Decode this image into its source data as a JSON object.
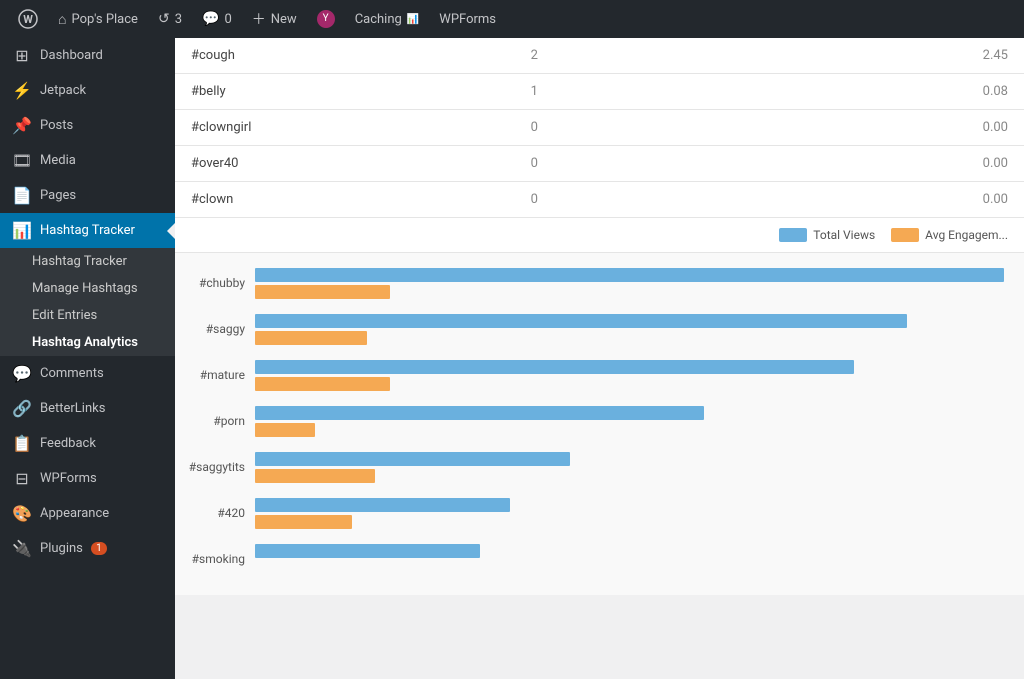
{
  "adminbar": {
    "wp_logo_label": "WordPress",
    "site_name": "Pop's Place",
    "updates_count": "3",
    "comments_count": "0",
    "new_label": "New",
    "yoast_label": "",
    "caching_label": "Caching",
    "wpforms_label": "WPForms"
  },
  "sidebar": {
    "items": [
      {
        "id": "dashboard",
        "label": "Dashboard",
        "icon": "⊞"
      },
      {
        "id": "jetpack",
        "label": "Jetpack",
        "icon": "⚡"
      },
      {
        "id": "posts",
        "label": "Posts",
        "icon": "📌"
      },
      {
        "id": "media",
        "label": "Media",
        "icon": "🎞"
      },
      {
        "id": "pages",
        "label": "Pages",
        "icon": "📄"
      },
      {
        "id": "hashtag-tracker",
        "label": "Hashtag Tracker",
        "icon": "📊",
        "active": true
      },
      {
        "id": "comments",
        "label": "Comments",
        "icon": "💬"
      },
      {
        "id": "betterlinks",
        "label": "BetterLinks",
        "icon": "🔗"
      },
      {
        "id": "feedback",
        "label": "Feedback",
        "icon": "📋"
      },
      {
        "id": "wpforms",
        "label": "WPForms",
        "icon": "⊟"
      },
      {
        "id": "appearance",
        "label": "Appearance",
        "icon": "🎨"
      },
      {
        "id": "plugins",
        "label": "Plugins",
        "icon": "🔌",
        "badge": "1"
      }
    ],
    "submenu": {
      "hashtag-tracker": [
        {
          "id": "hashtag-tracker-main",
          "label": "Hashtag Tracker"
        },
        {
          "id": "manage-hashtags",
          "label": "Manage Hashtags"
        },
        {
          "id": "edit-entries",
          "label": "Edit Entries"
        },
        {
          "id": "hashtag-analytics",
          "label": "Hashtag Analytics",
          "active": true
        }
      ]
    }
  },
  "table": {
    "rows": [
      {
        "tag": "#cough",
        "count": "2",
        "value": "2.45"
      },
      {
        "tag": "#belly",
        "count": "1",
        "value": "0.08"
      },
      {
        "tag": "#clowngirl",
        "count": "0",
        "value": "0.00"
      },
      {
        "tag": "#over40",
        "count": "0",
        "value": "0.00"
      },
      {
        "tag": "#clown",
        "count": "0",
        "value": "0.00"
      }
    ]
  },
  "legend": {
    "total_views_label": "Total Views",
    "avg_engagement_label": "Avg Engagem...",
    "total_views_color": "#6ab0de",
    "avg_engagement_color": "#f5a953"
  },
  "chart": {
    "items": [
      {
        "label": "#chubby",
        "blue_pct": 100,
        "orange_pct": 18
      },
      {
        "label": "#saggy",
        "blue_pct": 87,
        "orange_pct": 15
      },
      {
        "label": "#mature",
        "blue_pct": 80,
        "orange_pct": 18
      },
      {
        "label": "#porn",
        "blue_pct": 60,
        "orange_pct": 8
      },
      {
        "label": "#saggytits",
        "blue_pct": 42,
        "orange_pct": 16
      },
      {
        "label": "#420",
        "blue_pct": 34,
        "orange_pct": 13
      },
      {
        "label": "#smoking",
        "blue_pct": 30,
        "orange_pct": 0
      }
    ]
  }
}
